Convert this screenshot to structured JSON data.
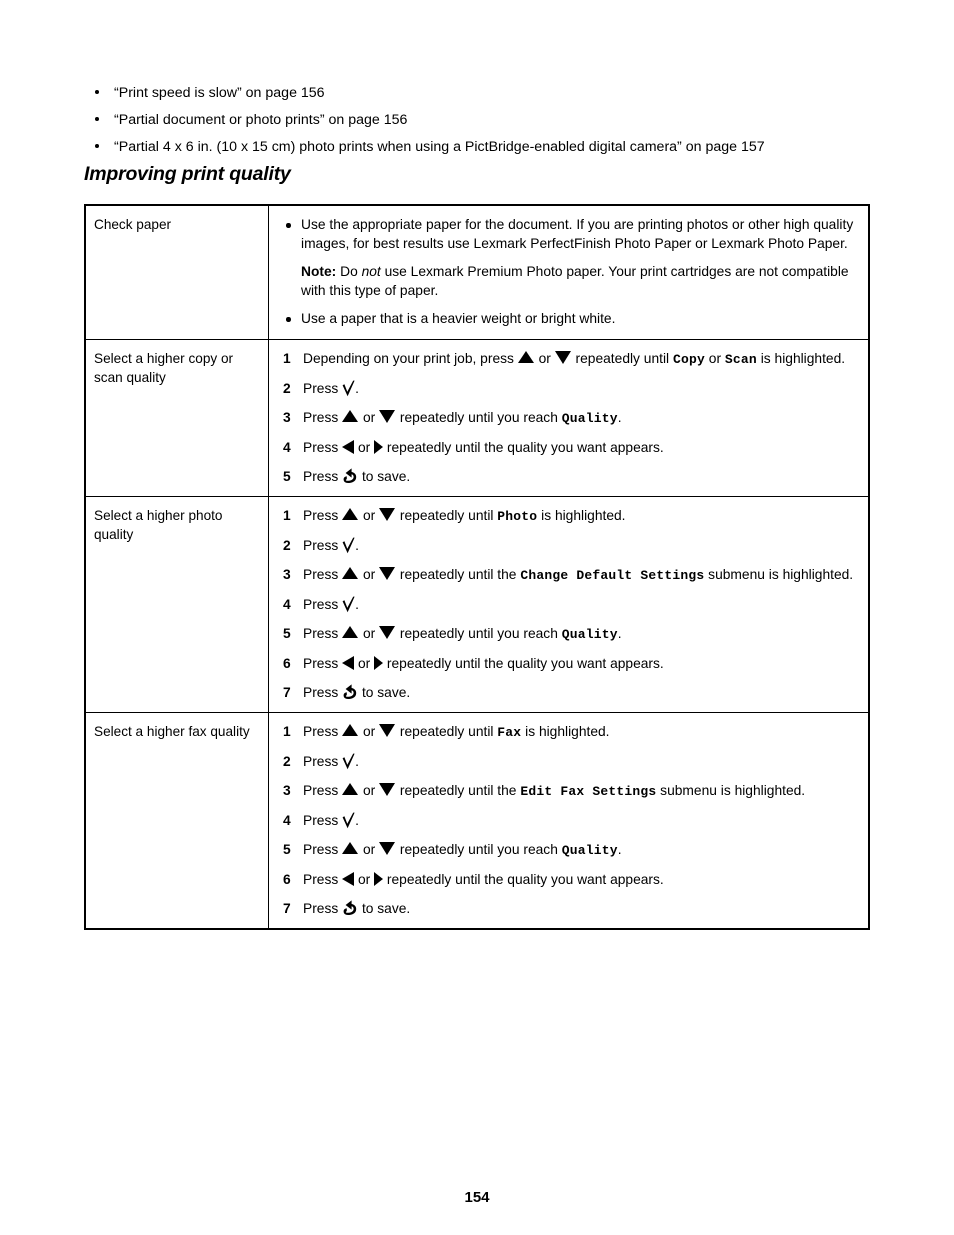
{
  "document": {
    "page_number": "154",
    "section_heading": "Improving print quality"
  },
  "cross_references": [
    {
      "text": "“Print speed is slow” on page 156"
    },
    {
      "text": "“Partial document or photo prints” on page 156"
    },
    {
      "text": "“Partial 4 x 6 in. (10 x 15 cm) photo prints when using a PictBridge-enabled digital camera” on page 157"
    }
  ],
  "table": {
    "rows": [
      {
        "label": "Check paper",
        "content": {
          "bullet_1": "Use the appropriate paper for the document. If you are printing photos or other high quality images, for best results use Lexmark PerfectFinish Photo Paper or Lexmark Photo Paper.",
          "note_label": "Note:",
          "note_before": " Do ",
          "note_italic": "not",
          "note_after": " use Lexmark Premium Photo paper. Your print cartridges are not compatible with this type of paper.",
          "bullet_2": "Use a paper that is a heavier weight or bright white."
        }
      },
      {
        "label": "Select a higher copy or scan quality",
        "steps": {
          "s1_num": "1",
          "s1_a": "Depending on your print job, press ",
          "s1_b": " or ",
          "s1_c": " repeatedly until ",
          "s1_code1": "Copy",
          "s1_d": " or ",
          "s1_code2": "Scan",
          "s1_e": " is highlighted.",
          "s2_num": "2",
          "s2_a": "Press ",
          "s2_b": ".",
          "s3_num": "3",
          "s3_a": "Press ",
          "s3_b": " or ",
          "s3_c": " repeatedly until you reach ",
          "s3_code": "Quality",
          "s3_d": ".",
          "s4_num": "4",
          "s4_a": "Press ",
          "s4_b": " or ",
          "s4_c": " repeatedly until the quality you want appears.",
          "s5_num": "5",
          "s5_a": "Press ",
          "s5_b": " to save."
        }
      },
      {
        "label": "Select a higher photo quality",
        "steps": {
          "s1_num": "1",
          "s1_a": "Press ",
          "s1_b": " or ",
          "s1_c": " repeatedly until ",
          "s1_code": "Photo",
          "s1_d": " is highlighted.",
          "s2_num": "2",
          "s2_a": "Press ",
          "s2_b": ".",
          "s3_num": "3",
          "s3_a": "Press ",
          "s3_b": " or ",
          "s3_c": " repeatedly until the ",
          "s3_code": "Change Default Settings",
          "s3_d": " submenu is highlighted.",
          "s4_num": "4",
          "s4_a": "Press ",
          "s4_b": ".",
          "s5_num": "5",
          "s5_a": "Press ",
          "s5_b": " or ",
          "s5_c": " repeatedly until you reach ",
          "s5_code": "Quality",
          "s5_d": ".",
          "s6_num": "6",
          "s6_a": "Press ",
          "s6_b": " or ",
          "s6_c": " repeatedly until the quality you want appears.",
          "s7_num": "7",
          "s7_a": "Press ",
          "s7_b": " to save."
        }
      },
      {
        "label": "Select a higher fax quality",
        "steps": {
          "s1_num": "1",
          "s1_a": "Press ",
          "s1_b": " or ",
          "s1_c": " repeatedly until ",
          "s1_code": "Fax",
          "s1_d": " is highlighted.",
          "s2_num": "2",
          "s2_a": "Press ",
          "s2_b": ".",
          "s3_num": "3",
          "s3_a": "Press ",
          "s3_b": " or ",
          "s3_c": " repeatedly until the ",
          "s3_code": "Edit Fax Settings",
          "s3_d": " submenu is highlighted.",
          "s4_num": "4",
          "s4_a": "Press ",
          "s4_b": ".",
          "s5_num": "5",
          "s5_a": "Press ",
          "s5_b": " or ",
          "s5_c": " repeatedly until you reach ",
          "s5_code": "Quality",
          "s5_d": ".",
          "s6_num": "6",
          "s6_a": "Press ",
          "s6_b": " or ",
          "s6_c": " repeatedly until the quality you want appears.",
          "s7_num": "7",
          "s7_a": "Press ",
          "s7_b": " to save."
        }
      }
    ]
  },
  "icons": {
    "up_arrow": "up-arrow-icon",
    "down_arrow": "down-arrow-icon",
    "left_arrow": "left-arrow-icon",
    "right_arrow": "right-arrow-icon",
    "select_check": "checkmark-select-icon",
    "back": "back-arrow-icon"
  },
  "colors": {
    "text": "#000000",
    "background": "#ffffff",
    "table_border": "#000000"
  }
}
